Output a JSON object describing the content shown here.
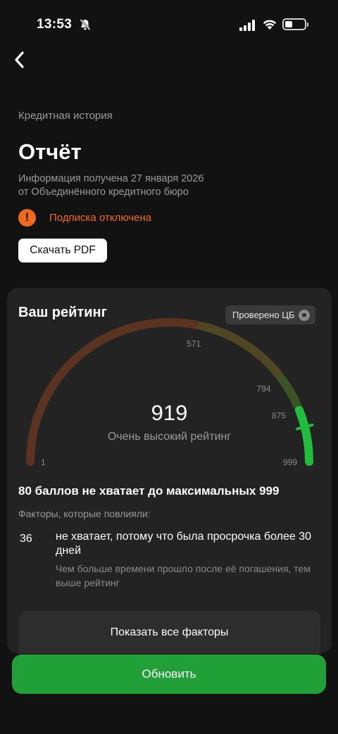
{
  "status_bar": {
    "time": "13:53"
  },
  "header": {
    "section_caption": "Кредитная история",
    "title": "Отчёт",
    "info_line_1": "Информация получена 27 января 2026",
    "info_line_2": "от Объединённого кредитного бюро"
  },
  "warning": {
    "text": "Подписка отключена",
    "color": "#f06a1c"
  },
  "pdf_button": {
    "label": "Скачать PDF"
  },
  "rating": {
    "title": "Ваш рейтинг",
    "verified_label": "Проверено ЦБ",
    "score": "919",
    "score_label": "Очень высокий рейтинг",
    "scale": {
      "min": 1,
      "max": 999
    },
    "ticks": [
      {
        "label": "1",
        "value": 1
      },
      {
        "label": "571",
        "value": 571
      },
      {
        "label": "794",
        "value": 794
      },
      {
        "label": "875",
        "value": 875
      },
      {
        "label": "999",
        "value": 999
      }
    ],
    "segment_colors": [
      "#5a3421",
      "#4f4723",
      "#3a5426",
      "#23bd3e"
    ],
    "max_note": "80 баллов не хватает до максимальных 999",
    "factors_caption": "Факторы, которые повлияли:",
    "factor": {
      "points": "36",
      "title": "не хватает, потому что была просрочка более 30 дней",
      "description": "Чем больше времени прошло после её погашения, тем выше рейтинг"
    },
    "show_all_label": "Показать все факторы"
  },
  "update_button": {
    "label": "Обновить",
    "color": "#21a038"
  }
}
